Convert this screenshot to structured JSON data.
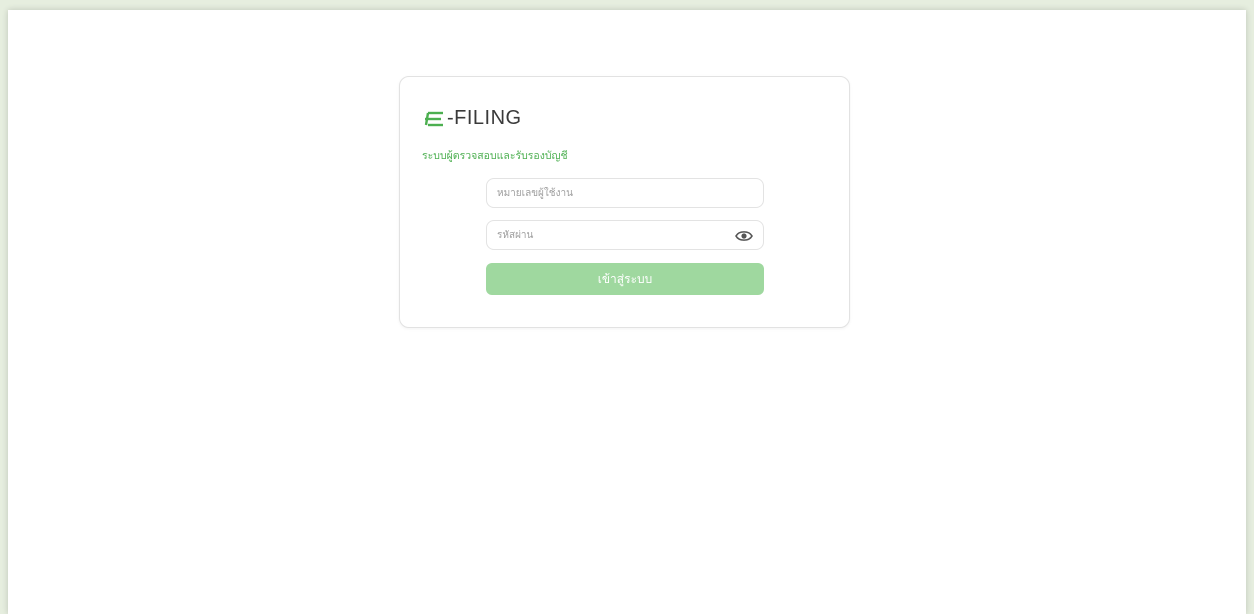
{
  "brand": {
    "logo_text": "-FILING",
    "logo_mark_icon": "e-letter-icon",
    "accent_color": "#4caf50"
  },
  "login": {
    "subtitle": "ระบบผู้ตรวจสอบและรับรองบัญชี",
    "username_placeholder": "หมายเลขผู้ใช้งาน",
    "password_placeholder": "รหัสผ่าน",
    "show_password_icon": "eye-icon",
    "submit_label": "เข้าสู่ระบบ",
    "button_color": "#9fd89f"
  }
}
